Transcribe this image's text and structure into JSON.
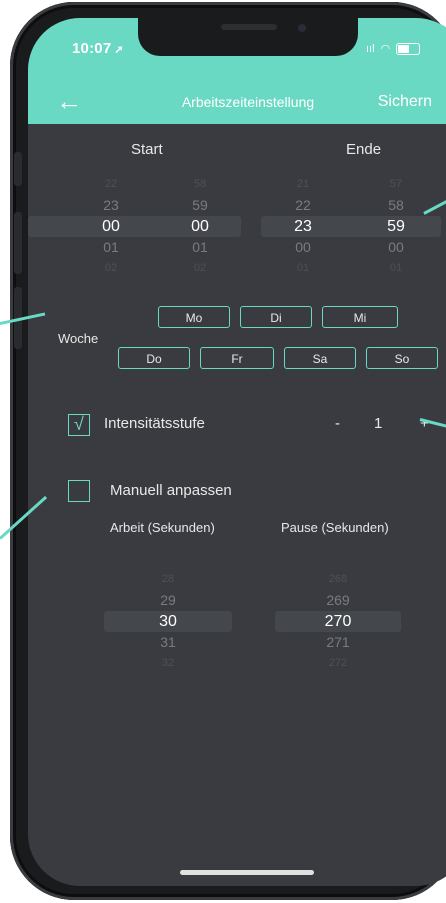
{
  "status_bar": {
    "time": "10:07",
    "location_icon": "location-arrow-icon",
    "signal_text": "ııl"
  },
  "header": {
    "back_icon": "back-arrow-icon",
    "back_glyph": "←",
    "title": "Arbeitszeiteinstellung",
    "save_label": "Sichern"
  },
  "time": {
    "start_label": "Start",
    "end_label": "Ende",
    "start_hour": [
      "22",
      "23",
      "00",
      "01",
      "02"
    ],
    "start_minute": [
      "58",
      "59",
      "00",
      "01",
      "02"
    ],
    "end_hour": [
      "21",
      "22",
      "23",
      "00",
      "01"
    ],
    "end_minute": [
      "57",
      "58",
      "59",
      "00",
      "01"
    ]
  },
  "week": {
    "label": "Woche",
    "days": [
      "Mo",
      "Di",
      "Mi",
      "Do",
      "Fr",
      "Sa",
      "So"
    ]
  },
  "intensity": {
    "checked": true,
    "check_glyph": "√",
    "label": "Intensitätsstufe",
    "minus": "-",
    "value": "1",
    "plus": "+"
  },
  "manual": {
    "checked": false,
    "label": "Manuell anpassen",
    "work_label": "Arbeit (Sekunden)",
    "pause_label": "Pause (Sekunden)"
  },
  "work_seconds": [
    "28",
    "29",
    "30",
    "31",
    "32"
  ],
  "pause_seconds": [
    "268",
    "269",
    "270",
    "271",
    "272"
  ],
  "colors": {
    "accent": "#6ad9c4",
    "background": "#393b40"
  }
}
